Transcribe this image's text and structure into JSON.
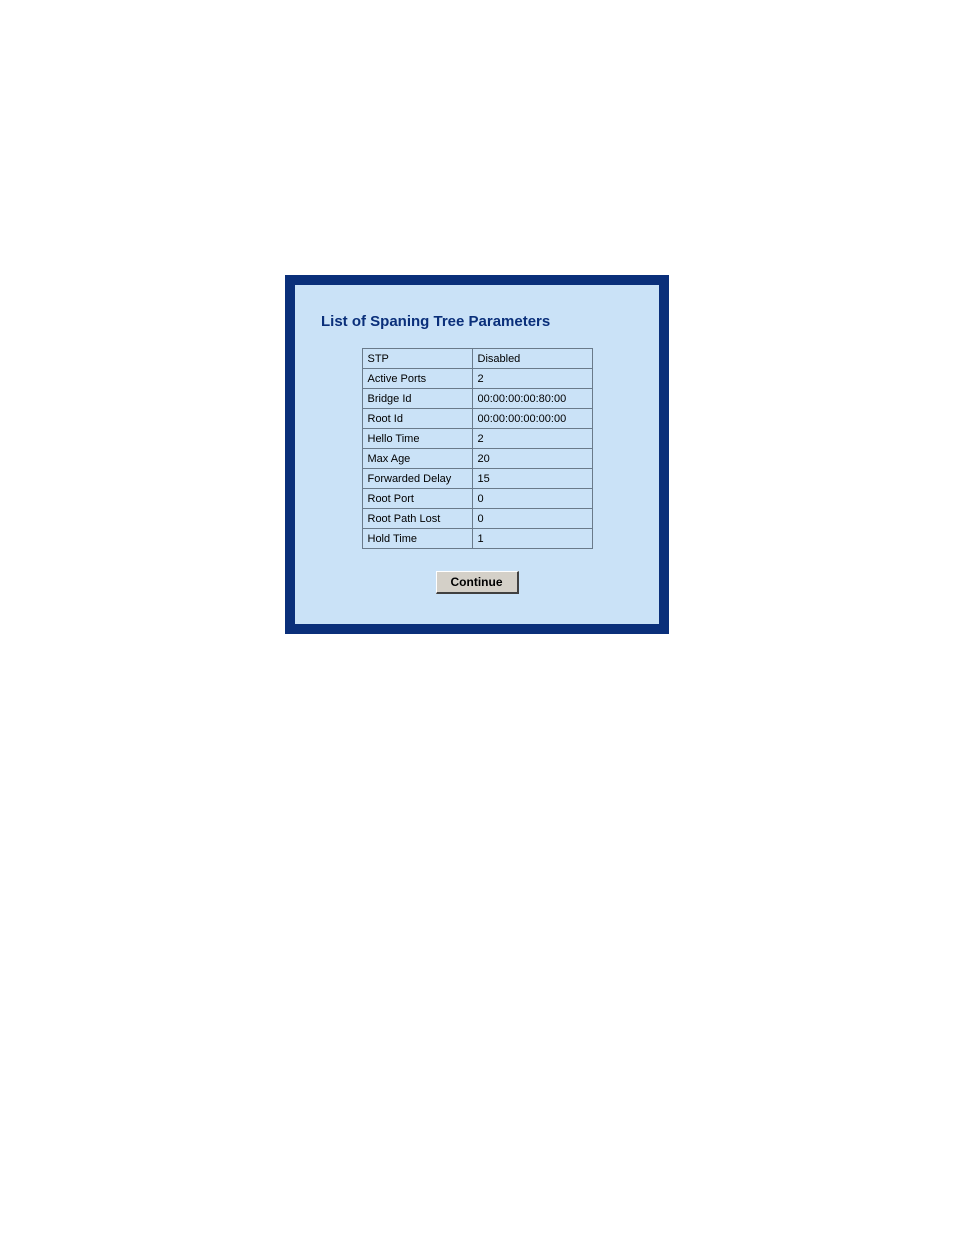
{
  "title": "List of Spaning Tree Parameters",
  "params": [
    {
      "label": "STP",
      "value": "Disabled"
    },
    {
      "label": "Active Ports",
      "value": "2"
    },
    {
      "label": "Bridge Id",
      "value": "00:00:00:00:80:00"
    },
    {
      "label": "Root Id",
      "value": "00:00:00:00:00:00"
    },
    {
      "label": "Hello Time",
      "value": "2"
    },
    {
      "label": "Max Age",
      "value": "20"
    },
    {
      "label": "Forwarded Delay",
      "value": "15"
    },
    {
      "label": "Root Port",
      "value": "0"
    },
    {
      "label": "Root Path Lost",
      "value": "0"
    },
    {
      "label": "Hold Time",
      "value": "1"
    }
  ],
  "button": {
    "continue": "Continue"
  }
}
